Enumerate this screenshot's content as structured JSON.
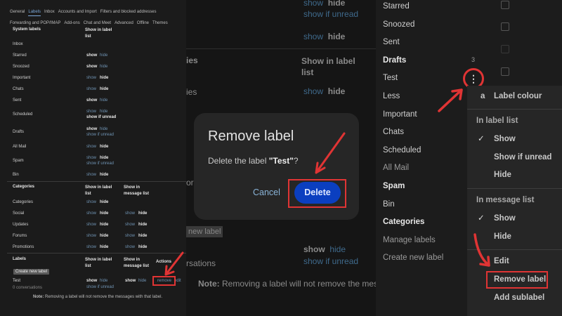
{
  "left": {
    "tabs_row1": [
      "General",
      "Labels",
      "Inbox",
      "Accounts and Import",
      "Filters and blocked addresses"
    ],
    "tabs_row2": [
      "Forwarding and POP/IMAP",
      "Add-ons",
      "Chat and Meet",
      "Advanced",
      "Offline",
      "Themes"
    ],
    "active_tab": "Labels",
    "system_header": "System labels",
    "show_in_label_list": "Show in label list",
    "show_in_message_list": "Show in message list",
    "actions_header": "Actions",
    "show": "show",
    "hide": "hide",
    "show_if_unread": "show if unread",
    "system_labels": [
      {
        "name": "Inbox",
        "list": null
      },
      {
        "name": "Starred",
        "list": "show"
      },
      {
        "name": "Snoozed",
        "list": "show"
      },
      {
        "name": "Important",
        "list": "hide"
      },
      {
        "name": "Chats",
        "list": "hide"
      },
      {
        "name": "Sent",
        "list": "show"
      },
      {
        "name": "Scheduled",
        "list": "unread",
        "unread": true
      },
      {
        "name": "Drafts",
        "list": "show",
        "unread": true
      },
      {
        "name": "All Mail",
        "list": "hide"
      },
      {
        "name": "Spam",
        "list": "hide",
        "unread": true
      },
      {
        "name": "Bin",
        "list": "hide"
      }
    ],
    "categories_header": "Categories",
    "categories": [
      {
        "name": "Categories",
        "list": "hide",
        "msg": null
      },
      {
        "name": "Social",
        "list": "hide",
        "msg": "hide"
      },
      {
        "name": "Updates",
        "list": "hide",
        "msg": "hide"
      },
      {
        "name": "Forums",
        "list": "hide",
        "msg": "hide"
      },
      {
        "name": "Promotions",
        "list": "hide",
        "msg": "hide"
      }
    ],
    "labels_header": "Labels",
    "create_new_label": "Create new label",
    "user_label": {
      "name": "Test",
      "count": "0 conversations",
      "list": "show",
      "msg": "show"
    },
    "remove": "remove",
    "edit": "edit",
    "note_bold": "Note:",
    "note_text": " Removing a label will not remove the messages with that label."
  },
  "middle": {
    "bg_show": "show",
    "bg_hide": "hide",
    "bg_unread": "show if unread",
    "bg_ies1": "ies",
    "bg_ies2": "ies",
    "bg_or": "or",
    "bg_header": "Show in label list",
    "bg_new_label": "new label",
    "bg_rsations": "rsations",
    "bg_note_bold": "Note:",
    "bg_note": " Removing a label will not remove the mes",
    "dialog": {
      "title": "Remove label",
      "message_prefix": "Delete the label ",
      "label_name": "\"Test\"",
      "message_suffix": "?",
      "cancel": "Cancel",
      "delete": "Delete"
    }
  },
  "right": {
    "nav": [
      {
        "label": "Starred"
      },
      {
        "label": "Snoozed"
      },
      {
        "label": "Sent"
      },
      {
        "label": "Drafts",
        "bold": true,
        "count": "3"
      },
      {
        "label": "Test"
      },
      {
        "label": "Less"
      },
      {
        "label": "Important"
      },
      {
        "label": "Chats"
      },
      {
        "label": "Scheduled"
      },
      {
        "label": "All Mail",
        "dim": true
      },
      {
        "label": "Spam",
        "bold": true
      },
      {
        "label": "Bin"
      },
      {
        "label": "Categories",
        "bold": true
      },
      {
        "label": "Manage labels",
        "dim": true
      },
      {
        "label": "Create new label",
        "dim": true
      }
    ],
    "menu": {
      "colour_glyph": "a",
      "label_colour": "Label colour",
      "in_label_list": "In label list",
      "ll_show": "Show",
      "ll_unread": "Show if unread",
      "ll_hide": "Hide",
      "in_message_list": "In message list",
      "ml_show": "Show",
      "ml_hide": "Hide",
      "edit": "Edit",
      "remove_label": "Remove label",
      "add_sublabel": "Add sublabel"
    }
  },
  "colors": {
    "annotation_red": "#e03434",
    "delete_blue": "#0b3fc0",
    "link_blue": "#6f93b3"
  }
}
